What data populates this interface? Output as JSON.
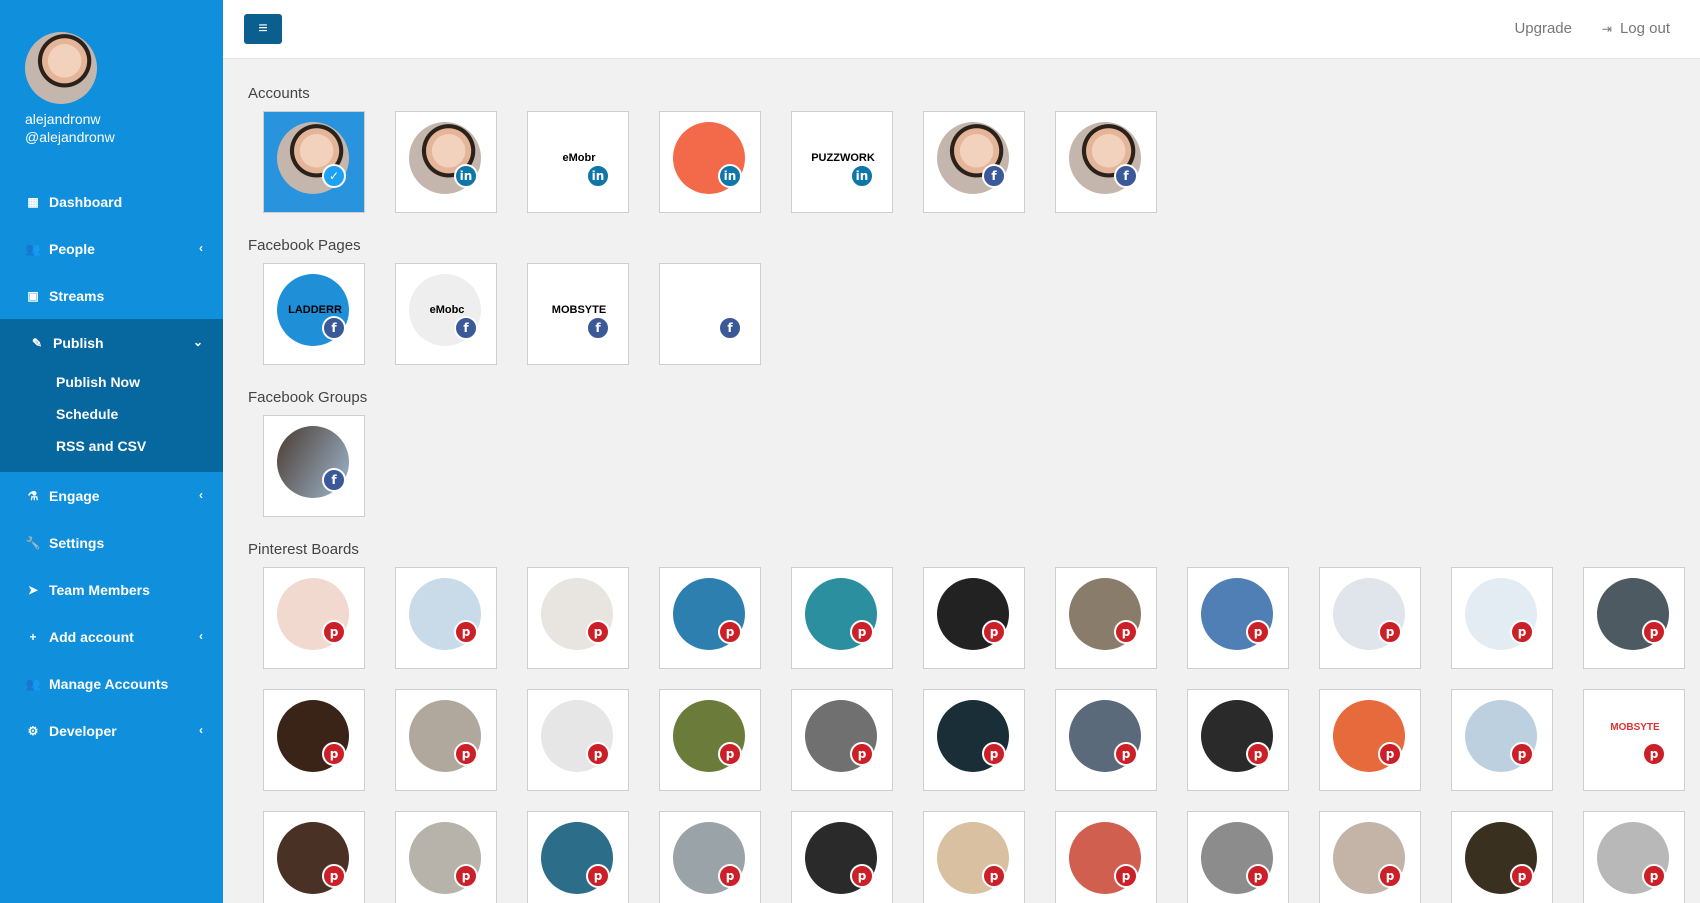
{
  "user": {
    "name": "alejandronw",
    "handle": "@alejandronw"
  },
  "nav": {
    "dashboard": "Dashboard",
    "people": "People",
    "streams": "Streams",
    "publish": "Publish",
    "publish_sub": [
      "Publish Now",
      "Schedule",
      "RSS and CSV"
    ],
    "engage": "Engage",
    "settings": "Settings",
    "team": "Team Members",
    "add_account": "Add account",
    "manage_accounts": "Manage Accounts",
    "developer": "Developer"
  },
  "topbar": {
    "menu_icon": "≡",
    "upgrade": "Upgrade",
    "logout": "Log out"
  },
  "sections": {
    "accounts": {
      "title": "Accounts",
      "tiles": [
        {
          "name": "alejandronw",
          "network": "twitter",
          "selected": true
        },
        {
          "name": "alejandronw",
          "network": "linkedin"
        },
        {
          "name": "eMobc",
          "network": "linkedin",
          "logo_text": "eMobr"
        },
        {
          "name": "orange-logo",
          "network": "linkedin"
        },
        {
          "name": "puzzwork",
          "network": "linkedin",
          "logo_text": "PUZZWORK"
        },
        {
          "name": "alejandronw",
          "network": "facebook"
        },
        {
          "name": "alejandronw",
          "network": "facebook"
        }
      ]
    },
    "facebook_pages": {
      "title": "Facebook Pages",
      "tiles": [
        {
          "name": "Ladderr",
          "network": "facebook",
          "logo_text": "LADDERR"
        },
        {
          "name": "eMobc",
          "network": "facebook",
          "logo_text": "eMobc"
        },
        {
          "name": "Mobsyte",
          "network": "facebook",
          "logo_text": "MOBSYTE"
        },
        {
          "name": "page",
          "network": "facebook"
        }
      ]
    },
    "facebook_groups": {
      "title": "Facebook Groups",
      "tiles": [
        {
          "name": "group",
          "network": "facebook"
        }
      ]
    },
    "pinterest_boards": {
      "title": "Pinterest Boards",
      "rows": [
        [
          "#f1d9d0",
          "#c9dbe8",
          "#e8e4df",
          "#2d7fb0",
          "#2b8fa0",
          "#222222",
          "#8a7c6a",
          "#4f7fb5",
          "#dfe5ea",
          "#e4ecf3",
          "#4e5a61"
        ],
        [
          "#3a2418",
          "#b0a89c",
          "#e6e6e6",
          "#6b7c3a",
          "#707070",
          "#1a2e38",
          "#5a6a7a",
          "#2a2a2a",
          "#e76a3d",
          "#bcd0e0",
          "#ffffff"
        ],
        [
          "#4a3126",
          "#b7b2aa",
          "#2c6e8a",
          "#9aa3a8",
          "#2a2a2a",
          "#d8c0a0",
          "#d15f50",
          "#8c8c8c",
          "#c4b4a8",
          "#3a3020",
          "#b8b8b8"
        ]
      ],
      "row2_last_logo": "MOBSYTE"
    }
  },
  "badge_glyphs": {
    "twitter": "✓",
    "linkedin": "in",
    "facebook": "f",
    "pinterest": "p"
  }
}
